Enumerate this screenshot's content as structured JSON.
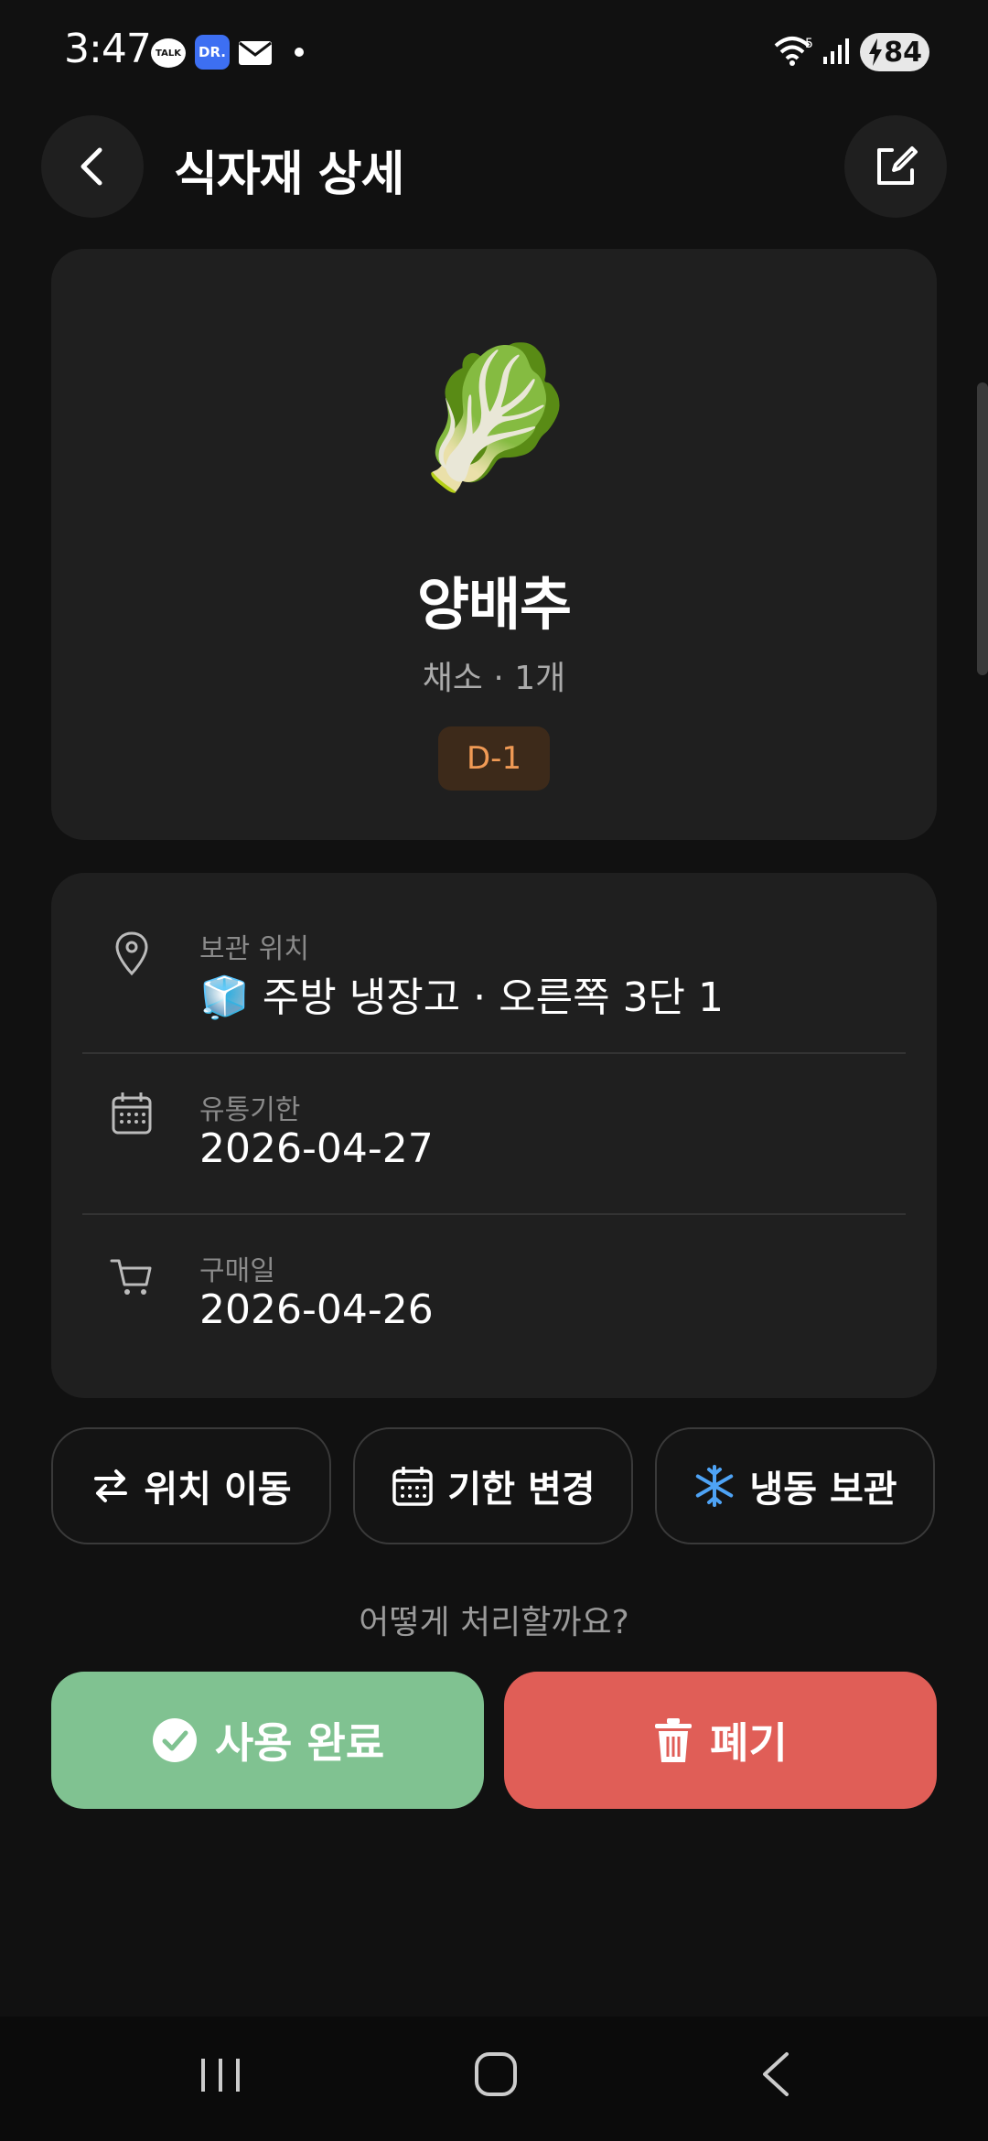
{
  "status_bar": {
    "time": "3:47",
    "talk_badge": "TALK",
    "dr_badge": "DR.",
    "battery": "84"
  },
  "header": {
    "title": "식자재 상세"
  },
  "item": {
    "emoji": "🥬",
    "name": "양배추",
    "subtitle": "채소 · 1개",
    "dday": "D-1"
  },
  "details": {
    "location_label": "보관 위치",
    "location_emoji": "🧊",
    "location_value": "주방 냉장고 · 오른쪽 3단 1",
    "expiry_label": "유통기한",
    "expiry_value": "2026-04-27",
    "purchase_label": "구매일",
    "purchase_value": "2026-04-26"
  },
  "actions": {
    "move_label": "위치 이동",
    "change_date_label": "기한 변경",
    "freeze_label": "냉동 보관"
  },
  "question": "어떻게 처리할까요?",
  "primary": {
    "done_label": "사용 완료",
    "discard_label": "폐기"
  },
  "colors": {
    "background": "#111111",
    "card": "#1f1f1f",
    "dday_text": "#f09a55",
    "done": "#80c291",
    "discard": "#e05e57",
    "freeze_icon": "#4ea3f5"
  },
  "icons": [
    "back-arrow-icon",
    "edit-icon",
    "location-pin-icon",
    "calendar-icon",
    "cart-icon",
    "swap-arrows-icon",
    "calendar-icon",
    "snowflake-icon",
    "check-circle-icon",
    "trash-icon"
  ]
}
